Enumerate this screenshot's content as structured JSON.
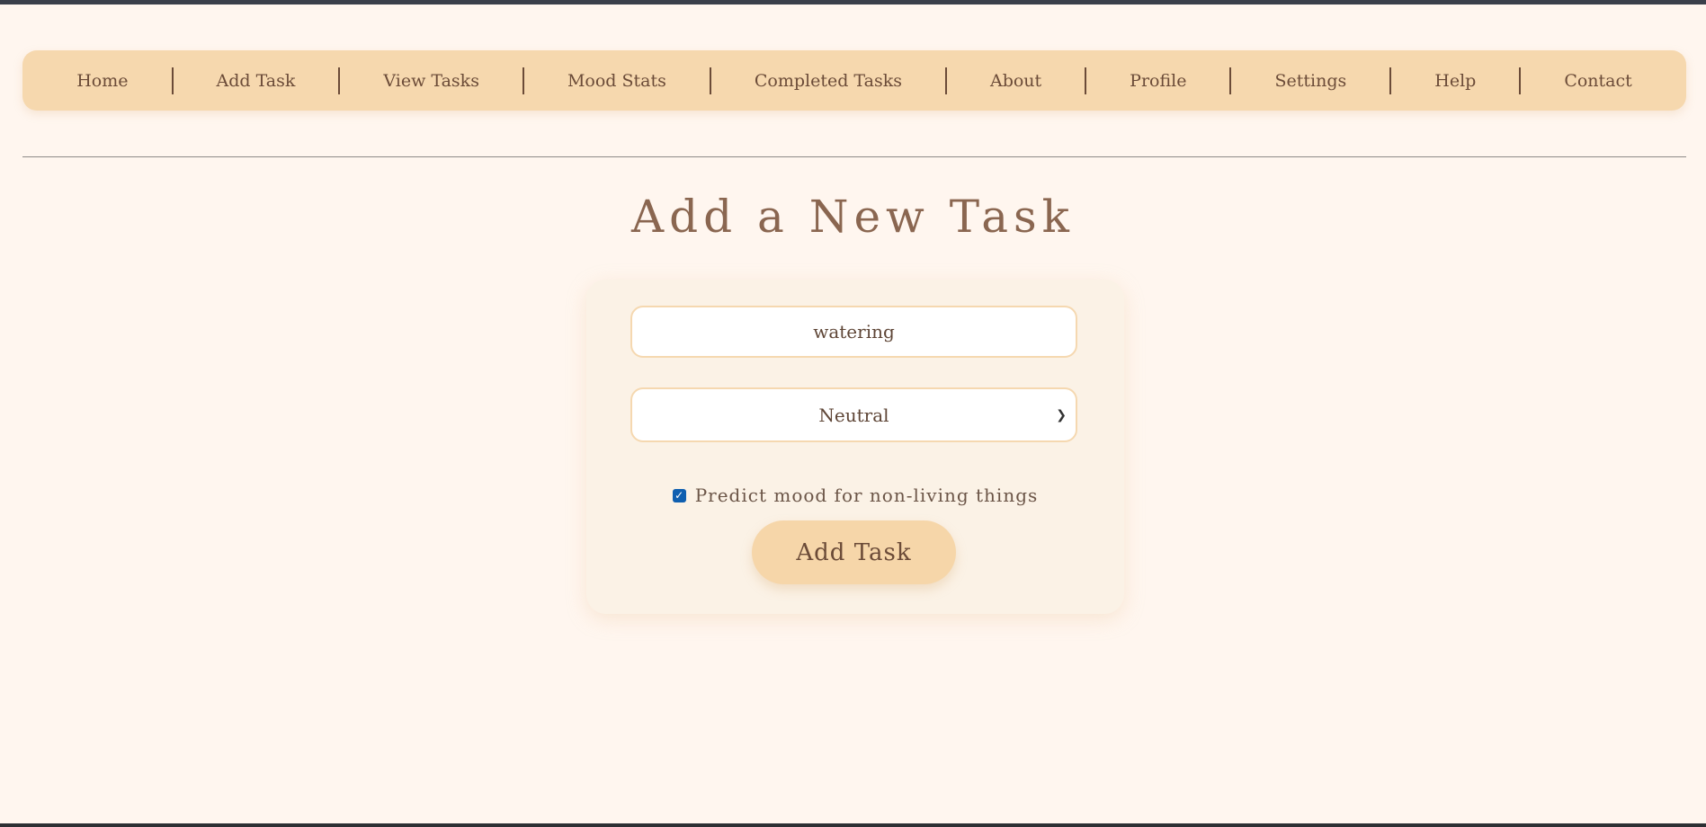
{
  "nav": {
    "items": [
      {
        "label": "Home"
      },
      {
        "label": "Add Task"
      },
      {
        "label": "View Tasks"
      },
      {
        "label": "Mood Stats"
      },
      {
        "label": "Completed Tasks"
      },
      {
        "label": "About"
      },
      {
        "label": "Profile"
      },
      {
        "label": "Settings"
      },
      {
        "label": "Help"
      },
      {
        "label": "Contact"
      }
    ]
  },
  "page": {
    "title": "Add a New Task"
  },
  "form": {
    "task_value": "watering",
    "mood_selected": "Neutral",
    "predict_checked": true,
    "predict_label": "Predict mood for non-living things",
    "submit_label": "Add Task"
  },
  "colors": {
    "background": "#fff6ef",
    "nav_bg": "#f6d8ae",
    "card_bg": "#fbf2e6",
    "button_bg": "#f6d6a9",
    "text": "#6b4b38",
    "checkbox": "#0f5fb0"
  },
  "icons": {
    "select_chevron": "chevron-down-icon",
    "checkbox_mark": "checkmark-icon"
  }
}
